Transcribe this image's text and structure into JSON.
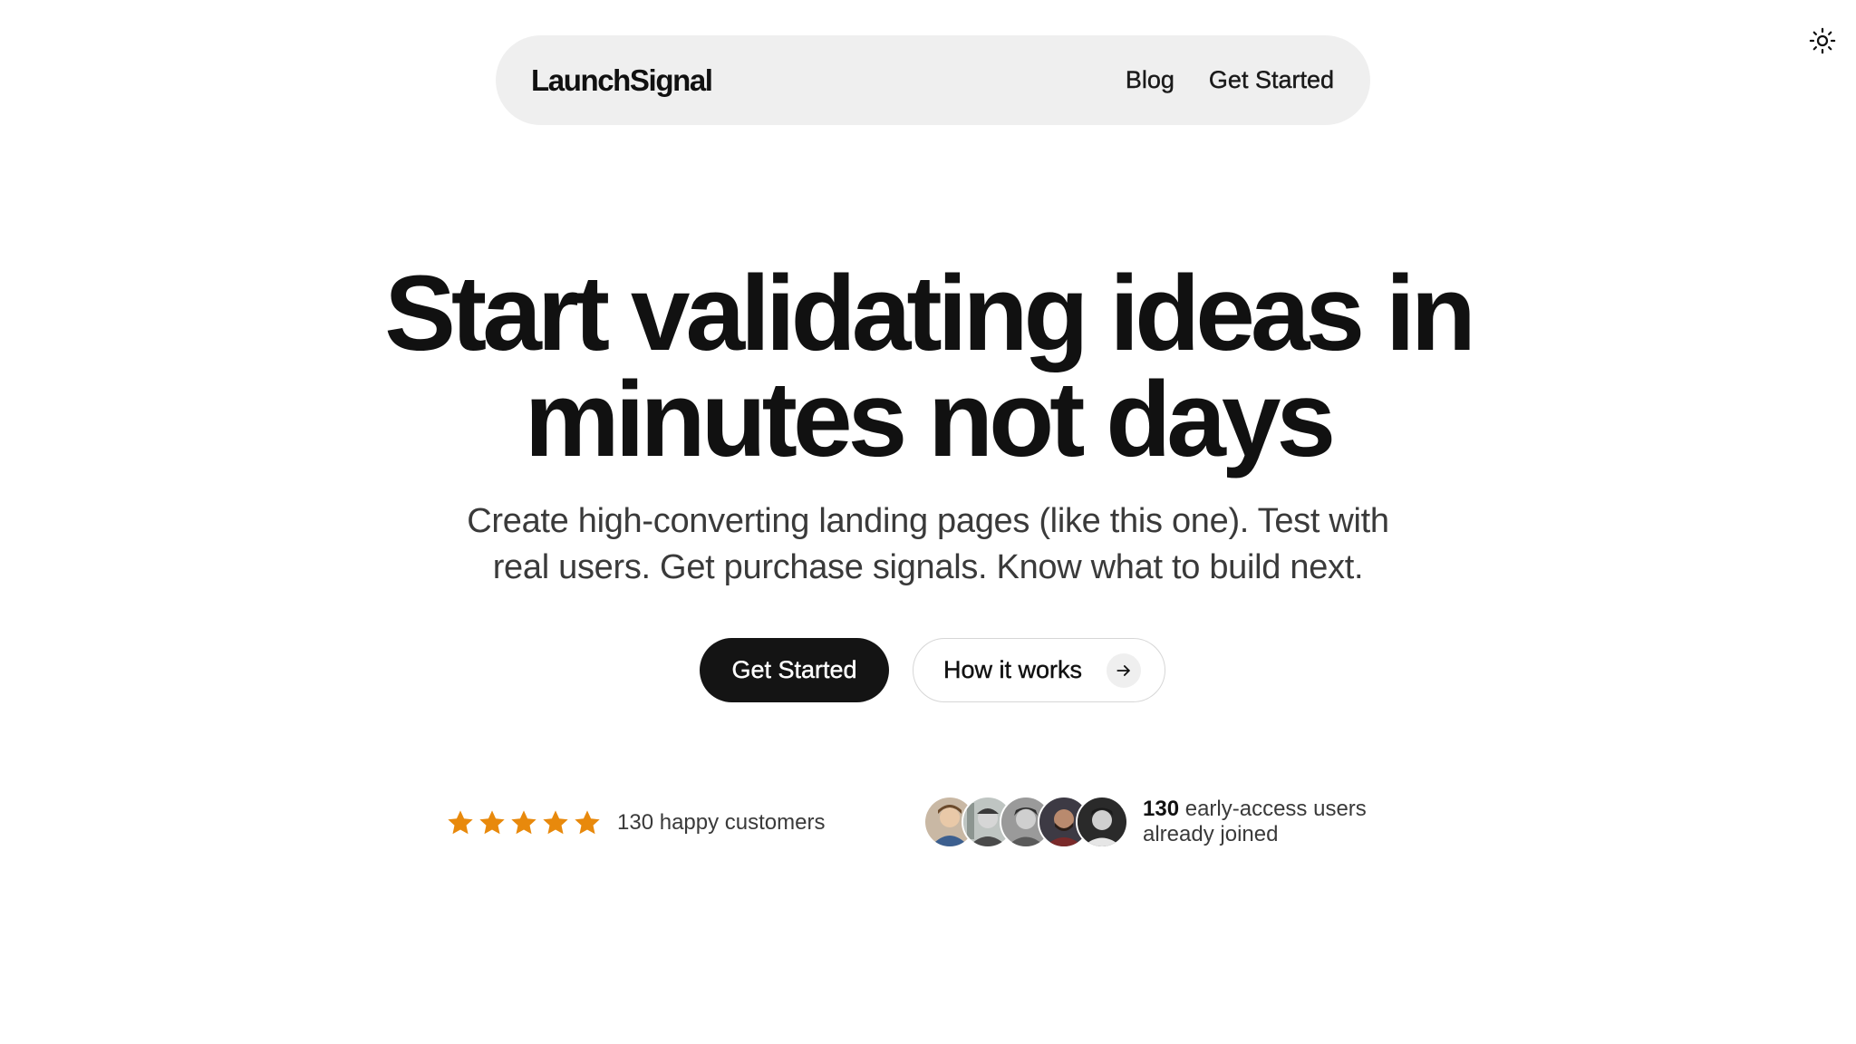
{
  "theme_toggle": {
    "icon": "sun-icon"
  },
  "nav": {
    "brand": "LaunchSignal",
    "links": [
      "Blog",
      "Get Started"
    ]
  },
  "hero": {
    "title_line1": "Start validating ideas in",
    "title_line2": "minutes not days",
    "subtitle_line1": "Create high-converting landing pages (like this one). Test with",
    "subtitle_line2": "real users. Get purchase signals. Know what to build next.",
    "primary_cta": "Get Started",
    "secondary_cta": "How it works",
    "secondary_cta_icon": "arrow-right-icon"
  },
  "social_proof": {
    "rating": {
      "stars": 5,
      "count": "130",
      "label": "happy customers"
    },
    "users": {
      "count": "130",
      "label_line1": "early-access users",
      "label_line2": "already joined",
      "avatar_count": 5
    }
  },
  "colors": {
    "star": "#e8890c",
    "primary_button": "#141414",
    "nav_background": "#efefef"
  }
}
